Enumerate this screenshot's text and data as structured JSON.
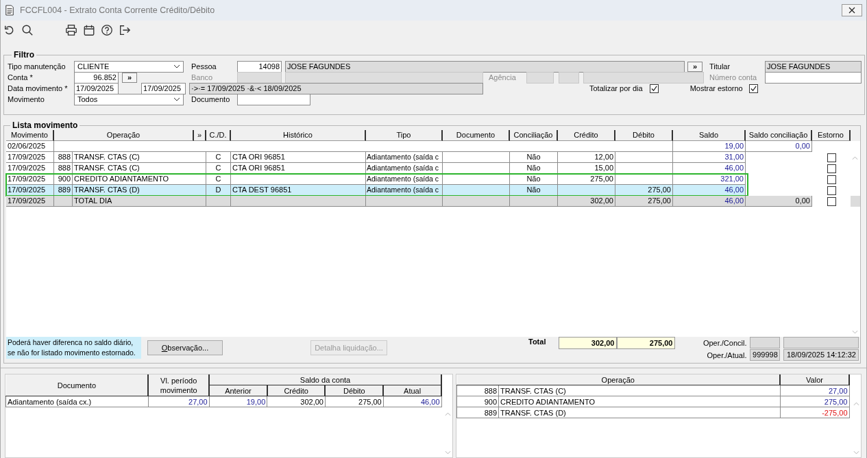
{
  "window": {
    "title": "FCCFL004 - Extrato Conta Corrente Crédito/Débito"
  },
  "filter": {
    "title": "Filtro",
    "tipo_manutencao": {
      "label": "Tipo manutenção",
      "value": "CLIENTE"
    },
    "pessoa": {
      "label": "Pessoa",
      "code": "14098",
      "name": "JOSE FAGUNDES",
      "button": "»"
    },
    "titular": {
      "label": "Titular",
      "value": "JOSE FAGUNDES"
    },
    "conta": {
      "label": "Conta *",
      "value": "96.852",
      "button": "»"
    },
    "banco": {
      "label": "Banco",
      "disabled": true
    },
    "agencia": {
      "label": "Agência",
      "disabled": true
    },
    "numero_conta": {
      "label": "Número conta",
      "disabled": true
    },
    "data_movimento": {
      "label": "Data movimento *",
      "from": "17/09/2025",
      "to": "17/09/2025",
      "expression": "·>·= 17/09/2025 ·&·< 18/09/2025"
    },
    "movimento": {
      "label": "Movimento",
      "value": "Todos"
    },
    "documento": {
      "label": "Documento"
    },
    "totalizar_por_dia": {
      "label": "Totalizar por dia",
      "checked": true
    },
    "mostrar_estorno": {
      "label": "Mostrar estorno",
      "checked": true
    }
  },
  "list": {
    "title": "Lista movimento",
    "columns": [
      "Movimento",
      "Operação",
      "»",
      "C./D.",
      "Histórico",
      "Tipo",
      "Documento",
      "Conciliação",
      "Crédito",
      "Débito",
      "Saldo",
      "Saldo conciliação",
      "Estorno"
    ],
    "rows": [
      {
        "kind": "balance",
        "movimento": "02/06/2025",
        "saldo": "19,00",
        "saldo_conciliacao": "0,00",
        "selected": false,
        "highlighted": false
      },
      {
        "kind": "entry",
        "movimento": "17/09/2025",
        "code": "888",
        "operacao": "TRANSF. CTAS (C)",
        "cd": "C",
        "historico": "CTA ORI  96851",
        "tipo": "Adiantamento (saída c",
        "conciliacao": "Não",
        "credito": "12,00",
        "saldo": "31,00",
        "estorno": false,
        "selected": false,
        "highlighted": false
      },
      {
        "kind": "entry",
        "movimento": "17/09/2025",
        "code": "888",
        "operacao": "TRANSF. CTAS (C)",
        "cd": "C",
        "historico": "CTA ORI  96851",
        "tipo": "Adiantamento (saída c",
        "conciliacao": "Não",
        "credito": "15,00",
        "saldo": "46,00",
        "estorno": false,
        "selected": false,
        "highlighted": false
      },
      {
        "kind": "entry",
        "movimento": "17/09/2025",
        "code": "900",
        "operacao": "CREDITO ADIANTAMENTO",
        "cd": "C",
        "tipo": "Adiantamento (saída c",
        "conciliacao": "Não",
        "credito": "275,00",
        "saldo": "321,00",
        "estorno": false,
        "selected": false,
        "highlighted": true
      },
      {
        "kind": "entry",
        "movimento": "17/09/2025",
        "code": "889",
        "operacao": "TRANSF. CTAS (D)",
        "cd": "D",
        "historico": "CTA DEST  96851",
        "tipo": "Adiantamento (saída c",
        "conciliacao": "Não",
        "debito": "275,00",
        "saldo": "46,00",
        "estorno": false,
        "selected": true,
        "highlighted": true
      },
      {
        "kind": "total",
        "movimento": "17/09/2025",
        "operacao": "TOTAL DIA",
        "credito": "302,00",
        "debito": "275,00",
        "saldo": "46,00",
        "saldo_conciliacao": "0,00",
        "estorno": false,
        "selected": false,
        "highlighted": false
      }
    ],
    "note": "Poderá haver diferenca no saldo diário, se não for listado movimento estornado.",
    "buttons": [
      {
        "label": "Observação...",
        "disabled": false
      },
      {
        "label": "Detalha liquidação...",
        "disabled": true
      }
    ],
    "total": {
      "label": "Total",
      "credito": "302,00",
      "debito": "275,00"
    },
    "oper_concil": {
      "label": "Oper./Concil."
    },
    "oper_atual": {
      "label": "Oper./Atual.",
      "code": "999998",
      "timestamp": "18/09/2025 14:12:32"
    }
  },
  "summary": {
    "headers": {
      "documento": "Documento",
      "periodo": "Vl. período movimento",
      "saldo_group": "Saldo da conta",
      "anterior": "Anterior",
      "credito": "Crédito",
      "debito": "Débito",
      "atual": "Atual"
    },
    "rows": [
      {
        "documento": "Adiantamento (saída cx.)",
        "periodo": "27,00",
        "anterior": "19,00",
        "credito": "302,00",
        "debito": "275,00",
        "atual": "46,00"
      }
    ]
  },
  "operations": {
    "columns": [
      "Operação",
      "Valor"
    ],
    "rows": [
      {
        "code": "888",
        "name": "TRANSF. CTAS (C)",
        "value": "27,00",
        "negative": false
      },
      {
        "code": "900",
        "name": "CREDITO ADIANTAMENTO",
        "value": "275,00",
        "negative": false
      },
      {
        "code": "889",
        "name": "TRANSF. CTAS (D)",
        "value": "-275,00",
        "negative": true
      }
    ]
  }
}
